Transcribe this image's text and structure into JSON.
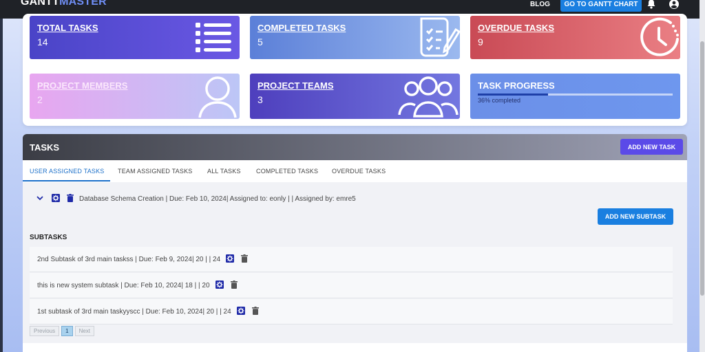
{
  "navbar": {
    "brand_part1": "GANTT",
    "brand_part2": "MASTER",
    "blog_label": "BLOG",
    "gantt_chart_label": "GO TO GANTT CHART",
    "bell_icon": "bell-icon",
    "user_icon": "user-circle-icon"
  },
  "stats": {
    "total": {
      "title": "TOTAL TASKS",
      "value": "14",
      "icon": "list-icon"
    },
    "completed": {
      "title": "COMPLETED TASKS",
      "value": "5",
      "icon": "checklist-pen-icon"
    },
    "overdue": {
      "title": "OVERDUE TASKS",
      "value": "9",
      "icon": "clock-icon"
    },
    "members": {
      "title": "PROJECT MEMBERS",
      "value": "2",
      "icon": "person-icon"
    },
    "teams": {
      "title": "PROJECT TEAMS",
      "value": "3",
      "icon": "group-icon"
    },
    "progress": {
      "title": "TASK PROGRESS",
      "text": "36% completed",
      "percent": 36
    }
  },
  "tasks": {
    "header": "TASKS",
    "add_task_label": "ADD NEW TASK",
    "tabs": [
      {
        "label": "USER ASSIGNED TASKS",
        "active": true
      },
      {
        "label": "TEAM ASSIGNED TASKS",
        "active": false
      },
      {
        "label": "ALL TASKS",
        "active": false
      },
      {
        "label": "COMPLETED TASKS",
        "active": false
      },
      {
        "label": "OVERDUE TASKS",
        "active": false
      }
    ],
    "main_task": {
      "text": "Database Schema Creation | Due: Feb 10, 2024| Assigned to: eonly | | Assigned by: emre5"
    },
    "add_subtask_label": "ADD NEW SUBTASK",
    "subtasks_label": "SUBTASKS",
    "subtasks": [
      {
        "text": "2nd Subtask of 3rd main taskss | Due: Feb 9, 2024| 20 | | 24"
      },
      {
        "text": "this is new system subtask | Due: Feb 10, 2024| 18 | | 20"
      },
      {
        "text": "1st subtask of 3rd main taskyyscc | Due: Feb 10, 2024| 20 | | 24"
      }
    ],
    "pager": {
      "previous": "Previous",
      "current": "1",
      "next": "Next"
    }
  },
  "colors": {
    "accent_blue": "#1a7fe0",
    "accent_purple": "#5b4ae8",
    "settings_icon_blue": "#1f2aa8"
  }
}
